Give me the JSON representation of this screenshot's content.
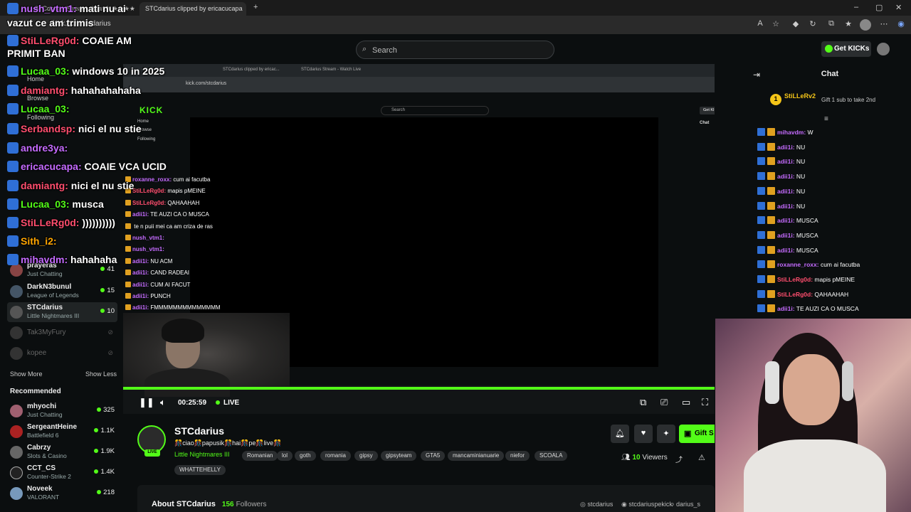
{
  "browser": {
    "tabs": [
      {
        "label": "STCdarius Stream - Watch ★★★★★"
      },
      {
        "label": "STCdarius clipped by ericacucapa"
      }
    ],
    "url": "kick.com/stcdarius"
  },
  "header": {
    "search_placeholder": "Search",
    "get_kicks_label": "Get KICKs"
  },
  "overlay_chat": [
    {
      "user": "nush_vtm1:",
      "msg": "mati nu ai",
      "color": "#c56bff"
    },
    {
      "user": "",
      "msg": "vazut ce am trimis",
      "color": "#ffffff"
    },
    {
      "user": "StiLLeRg0d:",
      "msg": "COAIE AM",
      "color": "#ff4e6e"
    },
    {
      "user": "",
      "msg": "PRIMIT BAN",
      "color": "#ffffff"
    },
    {
      "user": "Lucaa_03:",
      "msg": "windows 10 in 2025",
      "color": "#53fc18"
    },
    {
      "user": "damiantg:",
      "msg": "hahahahahaha",
      "color": "#ff4e6e"
    },
    {
      "user": "Lucaa_03:",
      "msg": "",
      "color": "#53fc18"
    },
    {
      "user": "Serbandsp:",
      "msg": "nici el nu stie",
      "color": "#ff4e6e"
    },
    {
      "user": "andre3ya:",
      "msg": "",
      "color": "#c56bff"
    },
    {
      "user": "ericacucapa:",
      "msg": "COAIE VCA UCID",
      "color": "#c56bff"
    },
    {
      "user": "damiantg:",
      "msg": "nici el nu stie",
      "color": "#ff4e6e"
    },
    {
      "user": "Lucaa_03:",
      "msg": "musca",
      "color": "#53fc18"
    },
    {
      "user": "StiLLeRg0d:",
      "msg": "))))))))))",
      "color": "#ff4e6e"
    },
    {
      "user": "Sith_i2:",
      "msg": "",
      "color": "#ffa500"
    },
    {
      "user": "mihavdm:",
      "msg": "hahahaha",
      "color": "#c56bff"
    }
  ],
  "sidebar": {
    "nav": [
      "Home",
      "Browse",
      "Following"
    ],
    "following": [
      {
        "name": "prayeras",
        "game": "Just Chatting",
        "viewers": "41",
        "color": "#884444"
      },
      {
        "name": "DarkN3bunul",
        "game": "League of Legends",
        "viewers": "15",
        "color": "#445566"
      },
      {
        "name": "STCdarius",
        "game": "Little Nightmares III",
        "viewers": "10",
        "color": "#555555"
      }
    ],
    "offline": [
      "Tak3MyFury",
      "kopee"
    ],
    "show_more": "Show More",
    "show_less": "Show Less",
    "recommended_title": "Recommended",
    "recommended": [
      {
        "name": "mhyochi",
        "game": "Just Chatting",
        "viewers": "325",
        "color": "#a06070"
      },
      {
        "name": "SergeantHeine",
        "game": "Battlefield 6",
        "viewers": "1.1K",
        "color": "#aa2222"
      },
      {
        "name": "Cabrzy",
        "game": "Slots & Casino",
        "viewers": "1.9K",
        "color": "#666666"
      },
      {
        "name": "CCT_CS",
        "game": "Counter-Strike 2",
        "viewers": "1.4K",
        "color": "#222222"
      },
      {
        "name": "Noveek",
        "game": "VALORANT",
        "viewers": "218",
        "color": "#7799bb"
      }
    ]
  },
  "player": {
    "inner_url": "kick.com/stcdarius",
    "inner_search": "Search",
    "inner_get_kicks": "Get KICKs",
    "inner_chat_title": "Chat",
    "inner_nav": [
      "Home",
      "Browse",
      "Following"
    ],
    "inner_chat": [
      {
        "user": "roxanne_roxx:",
        "msg": "cum ai facutba",
        "color": "#c56bff"
      },
      {
        "user": "StiLLeRg0d:",
        "msg": "mapis pMEINE",
        "color": "#ff4e6e"
      },
      {
        "user": "StiLLeRg0d:",
        "msg": "QAHAAHAH",
        "color": "#ff4e6e"
      },
      {
        "user": "adii1i:",
        "msg": "TE AUZI CA O MUSCA",
        "color": "#c56bff"
      },
      {
        "user": "",
        "msg": "te n puii mei ca am criza de ras",
        "color": "#ffffff"
      },
      {
        "user": "nush_vtm1:",
        "msg": "",
        "color": "#c56bff"
      },
      {
        "user": "nush_vtm1:",
        "msg": "",
        "color": "#c56bff"
      },
      {
        "user": "adii1i:",
        "msg": "NU ACM",
        "color": "#c56bff"
      },
      {
        "user": "adii1i:",
        "msg": "CAND RADEAI",
        "color": "#c56bff"
      },
      {
        "user": "adii1i:",
        "msg": "CUM AI FACUT",
        "color": "#c56bff"
      },
      {
        "user": "adii1i:",
        "msg": "PUNCH",
        "color": "#c56bff"
      },
      {
        "user": "adii1i:",
        "msg": "FMMMMMMMMMMMMMM",
        "color": "#c56bff"
      }
    ],
    "time": "00:25:59",
    "live_label": "LIVE",
    "progress": 1.0
  },
  "chat": {
    "title": "Chat",
    "pinned_user": "StiLLeRv2",
    "pinned_msg": "Gift 1 sub to take 2nd",
    "messages": [
      {
        "user": "mihavdm:",
        "msg": "W",
        "color": "#c56bff"
      },
      {
        "user": "adii1i:",
        "msg": "NU",
        "color": "#c56bff"
      },
      {
        "user": "adii1i:",
        "msg": "NU",
        "color": "#c56bff"
      },
      {
        "user": "adii1i:",
        "msg": "NU",
        "color": "#c56bff"
      },
      {
        "user": "adii1i:",
        "msg": "NU",
        "color": "#c56bff"
      },
      {
        "user": "adii1i:",
        "msg": "NU",
        "color": "#c56bff"
      },
      {
        "user": "adii1i:",
        "msg": "MUSCA",
        "color": "#c56bff"
      },
      {
        "user": "adii1i:",
        "msg": "MUSCA",
        "color": "#c56bff"
      },
      {
        "user": "adii1i:",
        "msg": "MUSCA",
        "color": "#c56bff"
      },
      {
        "user": "roxanne_roxx:",
        "msg": "cum ai facutba",
        "color": "#c56bff"
      },
      {
        "user": "StiLLeRg0d:",
        "msg": "mapis pMEINE",
        "color": "#ff4e6e"
      },
      {
        "user": "StiLLeRg0d:",
        "msg": "QAHAAHAH",
        "color": "#ff4e6e"
      },
      {
        "user": "adii1i:",
        "msg": "TE AUZI CA O MUSCA",
        "color": "#c56bff"
      }
    ]
  },
  "channel": {
    "name": "STCdarius",
    "live_badge": "LIVE",
    "title": "🎊ciao🎊papusik🎊hai🎊pe🎊live🎊",
    "category": "Little Nightmares III",
    "tags": [
      "Romanian",
      "lol",
      "goth",
      "romania",
      "gipsy",
      "gipsyteam",
      "GTA5",
      "mancaminianuarie",
      "niefor",
      "SCOALA",
      "WHATTEHELLY"
    ],
    "viewers_count": "10",
    "viewers_label": "Viewers",
    "gift_label": "Gift S",
    "about_label": "About STCdarius",
    "followers_count": "156",
    "followers_label": "Followers",
    "socials": [
      "stcdarius",
      "stcdariuspekick",
      "darius_s"
    ]
  },
  "colors": {
    "accent": "#53fc18",
    "bg": "#0b0e0f"
  }
}
